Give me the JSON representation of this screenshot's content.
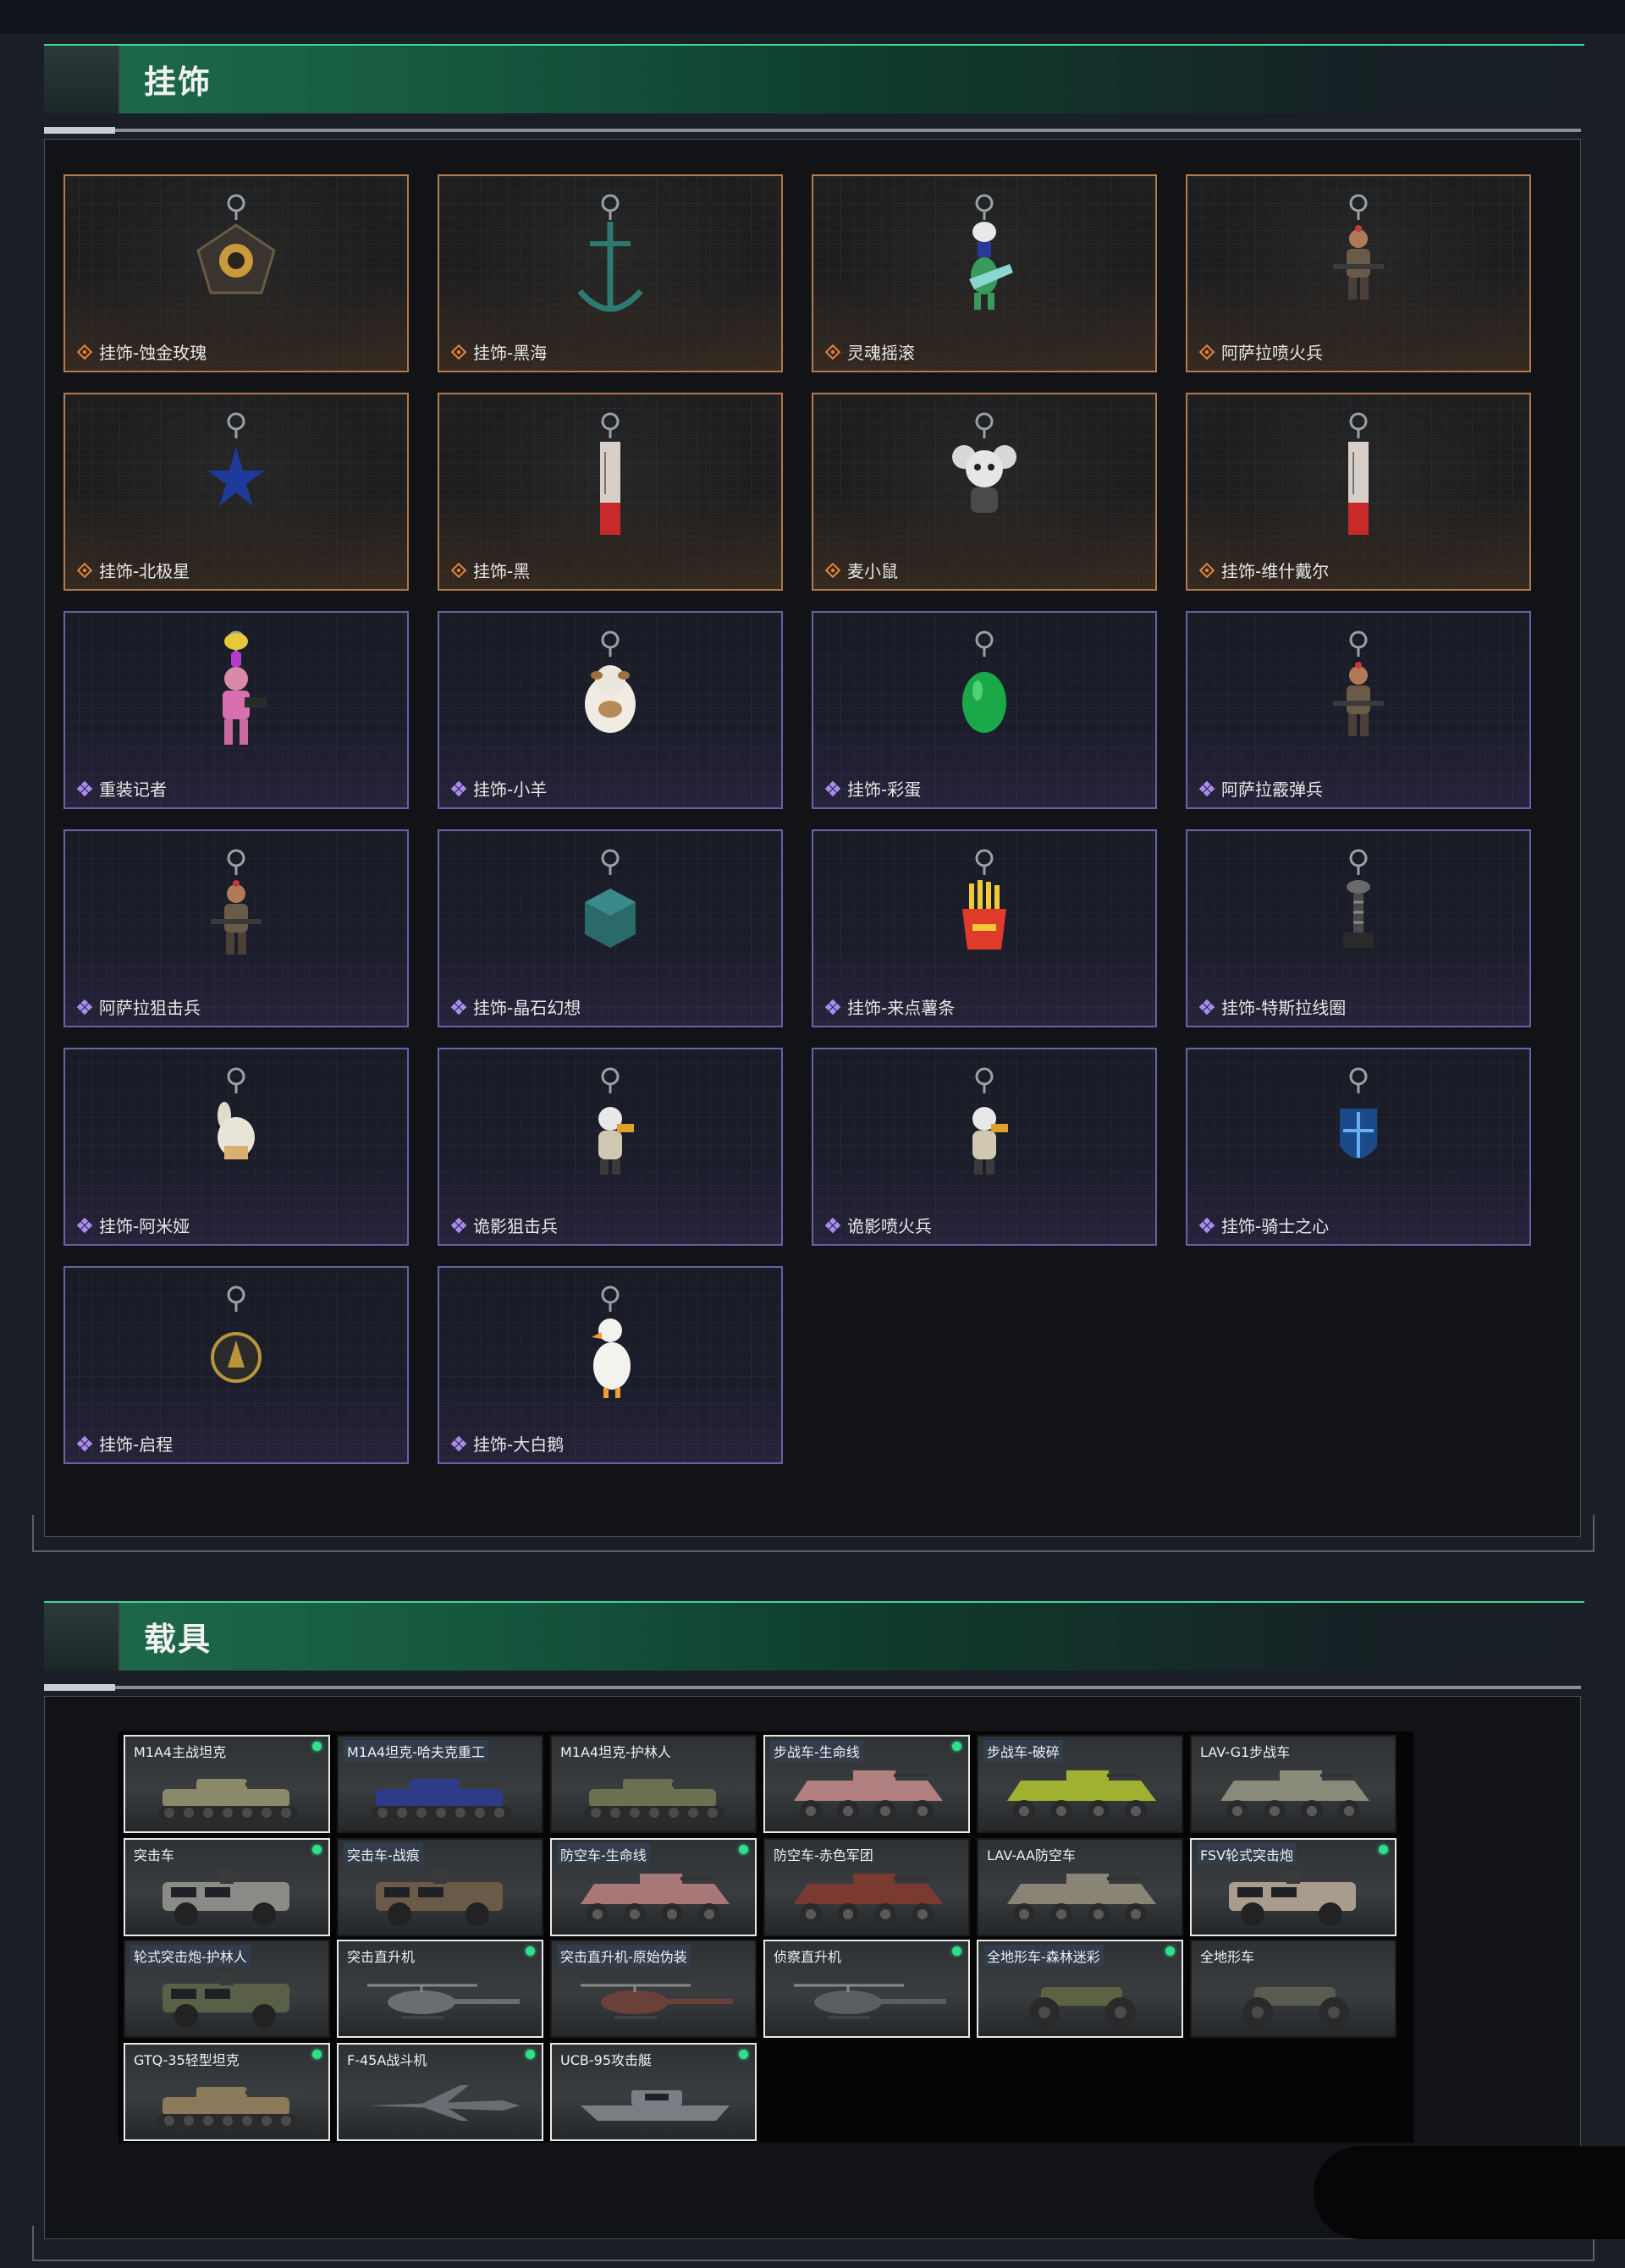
{
  "sections": {
    "charms": {
      "title": "挂饰"
    },
    "vehicles": {
      "title": "载具"
    }
  },
  "charms": [
    {
      "name": "挂饰-蚀金玫瑰",
      "rarity": "orange",
      "icon": "rose-badge-charm-icon"
    },
    {
      "name": "挂饰-黑海",
      "rarity": "orange",
      "icon": "anchor-charm-icon"
    },
    {
      "name": "灵魂摇滚",
      "rarity": "orange",
      "icon": "guitarist-figure-icon"
    },
    {
      "name": "阿萨拉喷火兵",
      "rarity": "orange",
      "icon": "soldier-figure-icon"
    },
    {
      "name": "挂饰-北极星",
      "rarity": "orange",
      "icon": "star-charm-icon"
    },
    {
      "name": "挂饰-黑",
      "rarity": "orange",
      "icon": "tag-charm-icon"
    },
    {
      "name": "麦小鼠",
      "rarity": "orange",
      "icon": "mouse-figure-icon"
    },
    {
      "name": "挂饰-维什戴尔",
      "rarity": "orange",
      "icon": "tag-charm-icon"
    },
    {
      "name": "重装记者",
      "rarity": "purple",
      "icon": "reporter-figure-icon"
    },
    {
      "name": "挂饰-小羊",
      "rarity": "purple",
      "icon": "sheep-figure-icon"
    },
    {
      "name": "挂饰-彩蛋",
      "rarity": "purple",
      "icon": "egg-charm-icon"
    },
    {
      "name": "阿萨拉霰弹兵",
      "rarity": "purple",
      "icon": "soldier-figure-icon"
    },
    {
      "name": "阿萨拉狙击兵",
      "rarity": "purple",
      "icon": "soldier-figure-icon"
    },
    {
      "name": "挂饰-晶石幻想",
      "rarity": "purple",
      "icon": "crystal-cube-icon"
    },
    {
      "name": "挂饰-来点薯条",
      "rarity": "purple",
      "icon": "fries-charm-icon"
    },
    {
      "name": "挂饰-特斯拉线圈",
      "rarity": "purple",
      "icon": "tesla-coil-icon"
    },
    {
      "name": "挂饰-阿米娅",
      "rarity": "purple",
      "icon": "bunny-figure-icon"
    },
    {
      "name": "诡影狙击兵",
      "rarity": "purple",
      "icon": "ghost-figure-icon"
    },
    {
      "name": "诡影喷火兵",
      "rarity": "purple",
      "icon": "ghost-figure-icon"
    },
    {
      "name": "挂饰-骑士之心",
      "rarity": "purple",
      "icon": "knight-shield-icon"
    },
    {
      "name": "挂饰-启程",
      "rarity": "purple",
      "icon": "medal-charm-icon"
    },
    {
      "name": "挂饰-大白鹅",
      "rarity": "purple",
      "icon": "goose-figure-icon"
    }
  ],
  "vehicles": [
    {
      "name": "M1A4主战坦克",
      "type": "tank",
      "dot": true,
      "hl": true,
      "bg": false,
      "color": "#8a8a6a"
    },
    {
      "name": "M1A4坦克-哈夫克重工",
      "type": "tank",
      "dot": false,
      "hl": false,
      "bg": true,
      "color": "#2e3a8a"
    },
    {
      "name": "M1A4坦克-护林人",
      "type": "tank",
      "dot": false,
      "hl": false,
      "bg": false,
      "color": "#6a7050"
    },
    {
      "name": "步战车-生命线",
      "type": "ifv",
      "dot": true,
      "hl": true,
      "bg": true,
      "color": "#b08080"
    },
    {
      "name": "步战车-破碎",
      "type": "ifv",
      "dot": false,
      "hl": false,
      "bg": true,
      "color": "#a0b030"
    },
    {
      "name": "LAV-G1步战车",
      "type": "ifv",
      "dot": false,
      "hl": false,
      "bg": false,
      "color": "#8a8a7a"
    },
    {
      "name": "突击车",
      "type": "truck",
      "dot": true,
      "hl": true,
      "bg": false,
      "color": "#8a8a86"
    },
    {
      "name": "突击车-战痕",
      "type": "truck",
      "dot": false,
      "hl": false,
      "bg": true,
      "color": "#6a5a48"
    },
    {
      "name": "防空车-生命线",
      "type": "ifv",
      "dot": true,
      "hl": true,
      "bg": true,
      "color": "#a87878"
    },
    {
      "name": "防空车-赤色军团",
      "type": "ifv",
      "dot": false,
      "hl": false,
      "bg": false,
      "color": "#7a3a30"
    },
    {
      "name": "LAV-AA防空车",
      "type": "ifv",
      "dot": false,
      "hl": false,
      "bg": false,
      "color": "#8a8476"
    },
    {
      "name": "FSV轮式突击炮",
      "type": "truck",
      "dot": true,
      "hl": true,
      "bg": true,
      "color": "#a89c8c"
    },
    {
      "name": "轮式突击炮-护林人",
      "type": "truck",
      "dot": false,
      "hl": false,
      "bg": true,
      "color": "#5a6048"
    },
    {
      "name": "突击直升机",
      "type": "heli",
      "dot": true,
      "hl": true,
      "bg": false,
      "color": "#6a6e70"
    },
    {
      "name": "突击直升机-原始伪装",
      "type": "heli",
      "dot": false,
      "hl": false,
      "bg": true,
      "color": "#6a4038"
    },
    {
      "name": "侦察直升机",
      "type": "heli",
      "dot": true,
      "hl": true,
      "bg": false,
      "color": "#5a5e60"
    },
    {
      "name": "全地形车-森林迷彩",
      "type": "atv",
      "dot": true,
      "hl": true,
      "bg": true,
      "color": "#5e6244"
    },
    {
      "name": "全地形车",
      "type": "atv",
      "dot": false,
      "hl": false,
      "bg": false,
      "color": "#5a5c50"
    },
    {
      "name": "GTQ-35轻型坦克",
      "type": "tank",
      "dot": true,
      "hl": true,
      "bg": false,
      "color": "#8a7a5a"
    },
    {
      "name": "F-45A战斗机",
      "type": "jet",
      "dot": true,
      "hl": true,
      "bg": false,
      "color": "#6a6e74"
    },
    {
      "name": "UCB-95攻击艇",
      "type": "boat",
      "dot": true,
      "hl": true,
      "bg": false,
      "color": "#7a7e84"
    }
  ],
  "colors": {
    "orange_border": "#b07a4c",
    "purple_border": "#6a5fa8",
    "accent_green": "#3fd69a",
    "status_dot": "#2ee08a"
  }
}
